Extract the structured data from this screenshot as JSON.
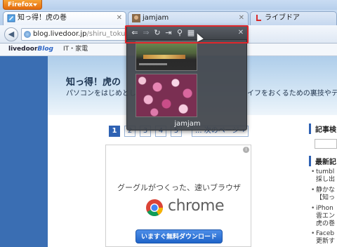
{
  "app": {
    "menu_button_label": "Firefox"
  },
  "tabs": [
    {
      "label": "知っ得！虎の巻",
      "active": true
    },
    {
      "label": "jamjam",
      "active": false
    },
    {
      "label": "ライブドア",
      "active": false
    }
  ],
  "navbar": {
    "url_host": "blog.livedoor.jp",
    "url_path": "/shiru_toku/"
  },
  "bookmarks": {
    "logo_text": "livedoor",
    "logo_blog": "Blog",
    "item1": "IT・家電"
  },
  "header": {
    "title": "知っ得！虎の",
    "description": "パソコンをはじめとした",
    "description_tail": "イフをおくるための裏技やテクニ"
  },
  "pager": {
    "pages": [
      "1",
      "2",
      "3",
      "4",
      "5"
    ],
    "next_label": "... 次のページ→"
  },
  "ad": {
    "info_glyph": "i",
    "headline": "グーグルがつくった、速いブラウザ",
    "product": "chrome",
    "cta": "いますぐ無料ダウンロード"
  },
  "sidebar": {
    "heading1": "記事検",
    "heading2": "最新記",
    "items": [
      [
        "tumbl",
        "採し出"
      ],
      [
        "静かな",
        "【知っ"
      ],
      [
        "iPhon",
        "雲エン",
        "虎の巻"
      ],
      [
        "Faceb",
        "更新す"
      ]
    ]
  },
  "popup": {
    "title": "jamjam",
    "toolbar_icons": [
      "back-icon",
      "forward-icon",
      "reload-icon",
      "go-to-tab-icon",
      "search-icon",
      "grid-icon"
    ]
  },
  "colors": {
    "firefox_orange": "#e36b0d",
    "highlight_red": "#e0262b",
    "link_blue": "#2f5ea6"
  }
}
